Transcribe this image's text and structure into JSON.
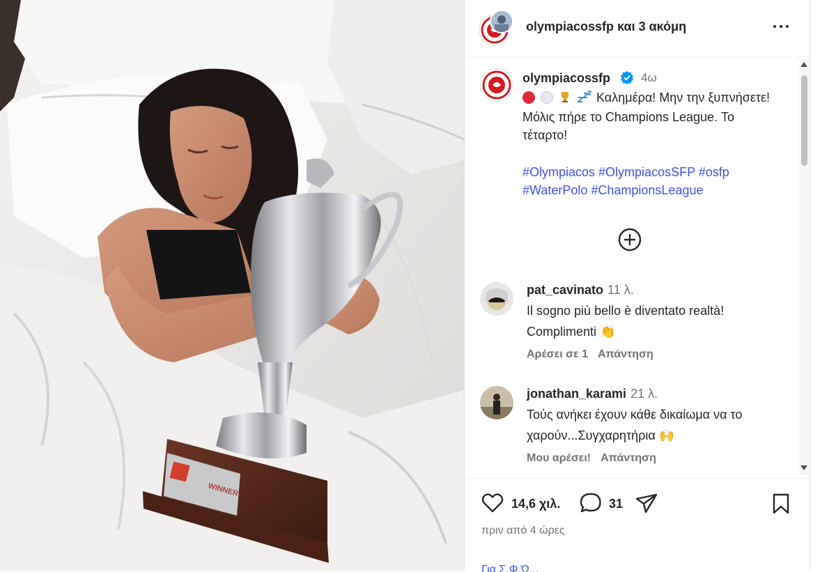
{
  "header": {
    "username": "olympiacossfp",
    "suffix": "και 3 ακόμη"
  },
  "caption": {
    "username": "olympiacossfp",
    "time": "4ω",
    "text": "Καλημέρα! Μην την ξυπνήσετε! Μόλις πήρε το Champions League. Το τέταρτο!",
    "hashtags": "#Olympiacos #OlympiacosSFP #osfp #WaterPolo #ChampionsLeague",
    "emojis": [
      "red-circle",
      "white-circle",
      "trophy",
      "zzz"
    ]
  },
  "comments": [
    {
      "username": "pat_cavinato",
      "time": "11 λ.",
      "text": "Il sogno più bello è diventato realtà! Complimenti 👏",
      "likes_label": "Αρέσει σε 1",
      "reply_label": "Απάντηση"
    },
    {
      "username": "jonathan_karami",
      "time": "21 λ.",
      "text": "Τούς ανήκει έχουν κάθε δικαίωμα να το χαρούν...Συγχαρητήρια 🙌",
      "likes_label": "Μου αρέσει!",
      "reply_label": "Απάντηση"
    }
  ],
  "footer": {
    "likes": "14,6 χιλ.",
    "comments": "31",
    "time_ago": "πριν από 4 ώρες",
    "bottom_link": "Για Σ.Φ.Ώ..."
  },
  "trophy": {
    "plate_text": "WINNER"
  },
  "colors": {
    "link": "#4150f7",
    "verified": "#0095f6",
    "club_red": "#d71920"
  }
}
